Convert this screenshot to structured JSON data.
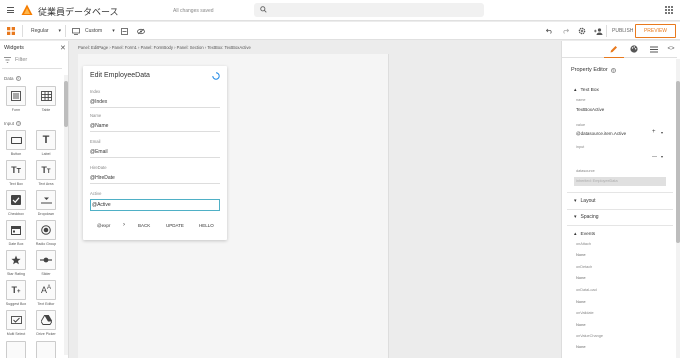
{
  "app": {
    "title": "従業員データベース",
    "save_status": "All changes saved"
  },
  "toolbar": {
    "theme": "Regular",
    "device": "Custom",
    "publish": "PUBLISH",
    "preview": "PREVIEW"
  },
  "left_panel": {
    "title": "Widgets",
    "filter_placeholder": "Filter",
    "sections": {
      "data": "Data",
      "input": "Input"
    },
    "widgets": [
      {
        "label": "Form",
        "icon": "form-icon"
      },
      {
        "label": "Table",
        "icon": "table-icon"
      },
      {
        "label": "Button",
        "icon": "button-icon"
      },
      {
        "label": "Label",
        "icon": "label-icon"
      },
      {
        "label": "Text Box",
        "icon": "text-box-icon"
      },
      {
        "label": "Text Area",
        "icon": "text-area-icon"
      },
      {
        "label": "Checkbox",
        "icon": "checkbox-icon"
      },
      {
        "label": "Dropdown",
        "icon": "dropdown-icon"
      },
      {
        "label": "Date Box",
        "icon": "date-box-icon"
      },
      {
        "label": "Radio Group",
        "icon": "radio-group-icon"
      },
      {
        "label": "Star Rating",
        "icon": "star-rating-icon"
      },
      {
        "label": "Slider",
        "icon": "slider-icon"
      },
      {
        "label": "Suggest Box",
        "icon": "suggest-box-icon"
      },
      {
        "label": "Text Editor",
        "icon": "text-editor-icon"
      },
      {
        "label": "Multi Select",
        "icon": "multi-select-icon"
      },
      {
        "label": "Drive Picker",
        "icon": "drive-picker-icon"
      }
    ]
  },
  "breadcrumb": "Panel: EditPage › Panel: Form1 › Panel: FormBody › Panel: Section › TextBox: TextBoxActive",
  "form": {
    "title": "Edit EmployeeData",
    "fields": [
      {
        "label": "Index",
        "value": "@Index"
      },
      {
        "label": "Name",
        "value": "@Name"
      },
      {
        "label": "Email",
        "value": "@Email"
      },
      {
        "label": "HireDate",
        "value": "@HireDate"
      },
      {
        "label": "Active",
        "value": "@Active"
      }
    ],
    "buttons": {
      "expr": "@expr",
      "chevron": "›",
      "back": "BACK",
      "update": "UPDATE",
      "hello": "HELLO"
    }
  },
  "right_panel": {
    "title": "Property Editor",
    "section_textbox": "Text Box",
    "props": {
      "name_label": "name",
      "name_value": "TextBoxActive",
      "value_label": "value",
      "value_value": "@datasource.item.Active",
      "input_label": "input",
      "datasource_label": "datasource",
      "datasource_value": "inherited: EmployeeData"
    },
    "section_layout": "Layout",
    "section_spacing": "Spacing",
    "section_events": "Events",
    "events": [
      {
        "label": "onAttach",
        "value": "None"
      },
      {
        "label": "onDetach",
        "value": "None"
      },
      {
        "label": "onDataLoad",
        "value": "None"
      },
      {
        "label": "onValidate",
        "value": "None"
      },
      {
        "label": "onValueChange",
        "value": "None"
      }
    ]
  },
  "colors": {
    "accent": "#e8791d",
    "focus": "#4fb0c6"
  }
}
